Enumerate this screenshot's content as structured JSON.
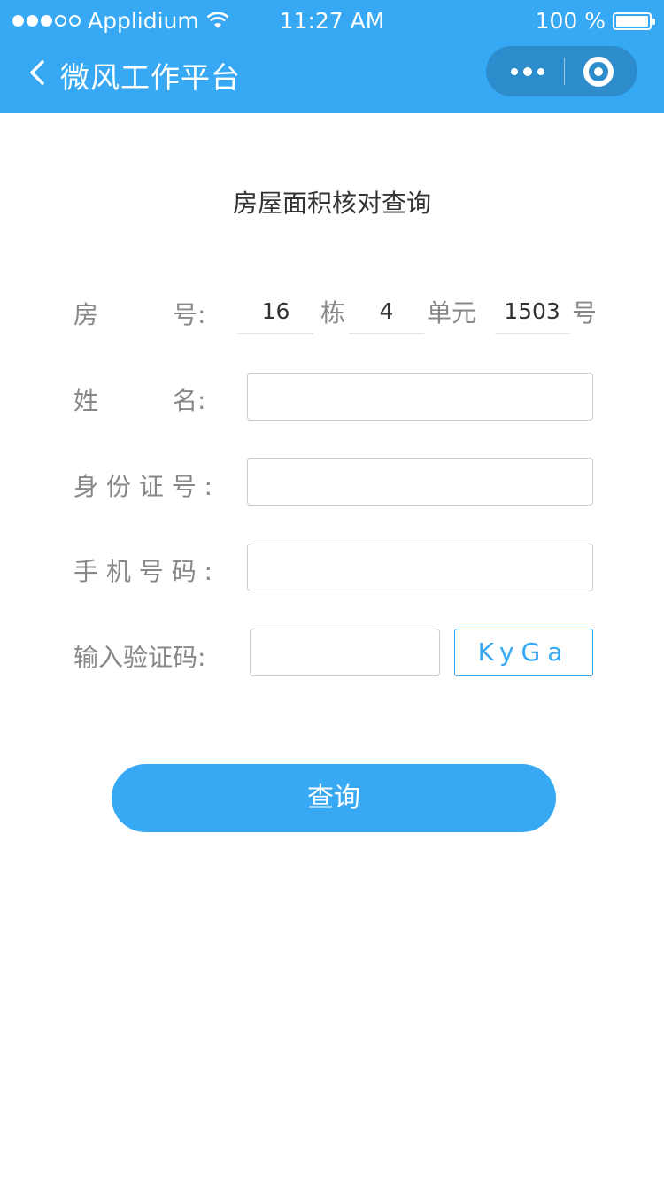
{
  "status_bar": {
    "carrier": "Applidium",
    "time": "11:27 AM",
    "battery": "100 %"
  },
  "nav": {
    "title": "微风工作平台"
  },
  "form": {
    "title": "房屋面积核对查询",
    "room_label_a": "房",
    "room_label_b": "号:",
    "building": "16",
    "building_unit": "栋",
    "unit_no": "4",
    "unit_unit": "单元",
    "room_no": "1503",
    "room_unit": "号",
    "name_label_a": "姓",
    "name_label_b": "名:",
    "id_label": "身 份 证 号 :",
    "phone_label": "手 机 号 码 :",
    "captcha_label": "输入验证码:",
    "captcha_text": "KyGa",
    "submit_label": "查询"
  },
  "colors": {
    "accent": "#36a8f4"
  }
}
